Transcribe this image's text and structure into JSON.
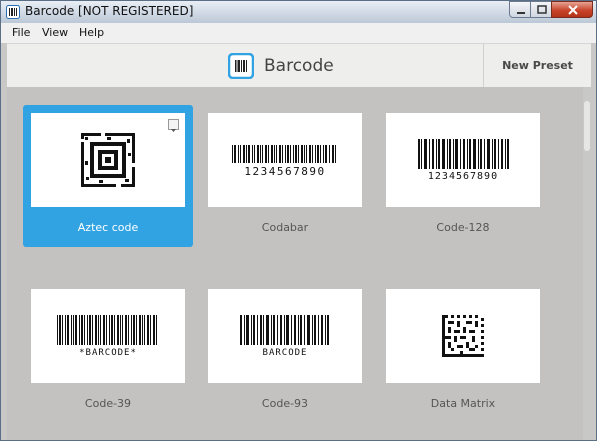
{
  "window": {
    "title": "Barcode [NOT REGISTERED]"
  },
  "menu": [
    "File",
    "View",
    "Help"
  ],
  "header": {
    "title": "Barcode",
    "new_preset": "New Preset"
  },
  "tiles": [
    {
      "label": "Aztec code",
      "selected": true,
      "icon": "aztec-code-icon"
    },
    {
      "label": "Codabar",
      "selected": false,
      "human_text": "1234567890",
      "icon": "codabar-icon"
    },
    {
      "label": "Code-128",
      "selected": false,
      "human_text": "1234567890",
      "icon": "code-128-icon"
    },
    {
      "label": "Code-39",
      "selected": false,
      "human_text": "*BARCODE*",
      "icon": "code-39-icon"
    },
    {
      "label": "Code-93",
      "selected": false,
      "human_text": "BARCODE",
      "icon": "code-93-icon"
    },
    {
      "label": "Data Matrix",
      "selected": false,
      "icon": "data-matrix-icon"
    }
  ],
  "colors": {
    "accent": "#31a3e2",
    "content_bg": "#c3c2c0",
    "header_bg": "#eeeeec"
  }
}
